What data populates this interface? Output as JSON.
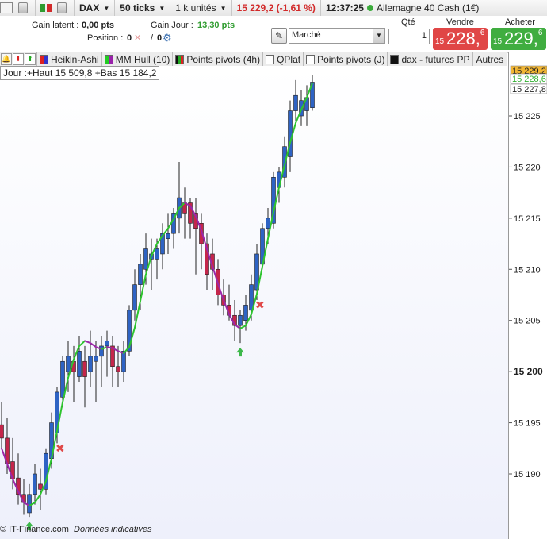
{
  "toolbar": {
    "instrument": "DAX",
    "ticks": "50 ticks",
    "units": "1 k unités",
    "price_change": "15 229,2 (-1,61 %)",
    "time": "12:37:25",
    "market": "Allemagne 40 Cash (1€)"
  },
  "order": {
    "gain_latent_label": "Gain latent :",
    "gain_latent_value": "0,00 pts",
    "gain_jour_label": "Gain Jour :",
    "gain_jour_value": "13,30 pts",
    "position_label": "Position :",
    "position_value": "0",
    "position_value2": "0",
    "order_type": "Marché",
    "qty_label": "Qté",
    "qty_value": "1",
    "sell_label": "Vendre",
    "sell_small": "15",
    "sell_big": "228,",
    "sell_sup": "6",
    "buy_label": "Acheter",
    "buy_small": "15",
    "buy_big": "229,",
    "buy_sup": "6"
  },
  "indicators": [
    "Heikin-Ashi",
    "MM Hull (10)",
    "Points pivots (4h)",
    "QPlat",
    "Points pivots (J)",
    "dax - futures PP",
    "Autres"
  ],
  "info_text": "Jour :+Haut 15 509,8 +Bas 15 184,2",
  "footer": {
    "source": "© IT-Finance.com",
    "note": "Données indicatives"
  },
  "price_labels": {
    "current": "15 229,2",
    "green": "15 228,6",
    "last": "15 227,8"
  },
  "colors": {
    "up": "#2e63c4",
    "down": "#c4264b",
    "hull_up": "#2ec42e",
    "hull_down": "#9b27a8",
    "current_price_bg": "#f2b633"
  },
  "chart_data": {
    "type": "candlestick",
    "y_ticks": [
      "15 190",
      "15 195",
      "15 200",
      "15 205",
      "15 210",
      "15 215",
      "15 220",
      "15 225"
    ],
    "ylim": [
      15185.5,
      15229.0
    ],
    "candles": [
      {
        "o": 15194.8,
        "h": 15197.0,
        "l": 15192.5,
        "c": 15193.5
      },
      {
        "o": 15193.5,
        "h": 15195.5,
        "l": 15190.0,
        "c": 15191.0
      },
      {
        "o": 15191.2,
        "h": 15193.5,
        "l": 15188.5,
        "c": 15189.5
      },
      {
        "o": 15189.6,
        "h": 15192.0,
        "l": 15187.0,
        "c": 15188.0
      },
      {
        "o": 15188.0,
        "h": 15189.5,
        "l": 15186.0,
        "c": 15187.2
      },
      {
        "o": 15186.2,
        "h": 15189.0,
        "l": 15185.8,
        "c": 15188.0
      },
      {
        "o": 15188.0,
        "h": 15191.0,
        "l": 15187.0,
        "c": 15190.0
      },
      {
        "o": 15189.0,
        "h": 15190.5,
        "l": 15186.5,
        "c": 15188.5
      },
      {
        "o": 15188.5,
        "h": 15192.5,
        "l": 15188.0,
        "c": 15192.0
      },
      {
        "o": 15191.5,
        "h": 15196.0,
        "l": 15190.5,
        "c": 15195.0
      },
      {
        "o": 15194.0,
        "h": 15198.5,
        "l": 15193.0,
        "c": 15198.0
      },
      {
        "o": 15197.5,
        "h": 15201.5,
        "l": 15196.5,
        "c": 15201.0
      },
      {
        "o": 15200.0,
        "h": 15203.0,
        "l": 15198.0,
        "c": 15201.5
      },
      {
        "o": 15201.0,
        "h": 15202.5,
        "l": 15197.0,
        "c": 15200.0
      },
      {
        "o": 15199.5,
        "h": 15203.5,
        "l": 15199.0,
        "c": 15202.0
      },
      {
        "o": 15201.0,
        "h": 15202.5,
        "l": 15196.5,
        "c": 15199.5
      },
      {
        "o": 15200.0,
        "h": 15204.0,
        "l": 15198.5,
        "c": 15201.5
      },
      {
        "o": 15201.0,
        "h": 15203.0,
        "l": 15197.0,
        "c": 15201.5
      },
      {
        "o": 15201.5,
        "h": 15203.5,
        "l": 15198.5,
        "c": 15202.5
      },
      {
        "o": 15202.5,
        "h": 15204.0,
        "l": 15199.5,
        "c": 15203.0
      },
      {
        "o": 15202.5,
        "h": 15203.5,
        "l": 15198.5,
        "c": 15200.5
      },
      {
        "o": 15200.5,
        "h": 15202.5,
        "l": 15198.5,
        "c": 15200.0
      },
      {
        "o": 15200.0,
        "h": 15203.0,
        "l": 15199.0,
        "c": 15202.0
      },
      {
        "o": 15202.0,
        "h": 15206.5,
        "l": 15201.5,
        "c": 15206.0
      },
      {
        "o": 15206.0,
        "h": 15210.0,
        "l": 15205.0,
        "c": 15208.5
      },
      {
        "o": 15208.5,
        "h": 15211.5,
        "l": 15206.0,
        "c": 15210.5
      },
      {
        "o": 15210.0,
        "h": 15213.5,
        "l": 15208.5,
        "c": 15212.0
      },
      {
        "o": 15211.0,
        "h": 15213.0,
        "l": 15208.0,
        "c": 15211.5
      },
      {
        "o": 15211.0,
        "h": 15213.0,
        "l": 15209.0,
        "c": 15212.0
      },
      {
        "o": 15211.5,
        "h": 15214.5,
        "l": 15210.0,
        "c": 15213.5
      },
      {
        "o": 15213.0,
        "h": 15215.5,
        "l": 15211.5,
        "c": 15213.5
      },
      {
        "o": 15213.5,
        "h": 15216.0,
        "l": 15212.0,
        "c": 15215.5
      },
      {
        "o": 15215.0,
        "h": 15220.5,
        "l": 15213.5,
        "c": 15217.0
      },
      {
        "o": 15216.5,
        "h": 15218.0,
        "l": 15213.0,
        "c": 15215.5
      },
      {
        "o": 15216.5,
        "h": 15217.0,
        "l": 15213.0,
        "c": 15214.5
      },
      {
        "o": 15215.5,
        "h": 15217.0,
        "l": 15209.5,
        "c": 15214.0
      },
      {
        "o": 15214.5,
        "h": 15215.5,
        "l": 15210.0,
        "c": 15212.5
      },
      {
        "o": 15212.5,
        "h": 15213.5,
        "l": 15208.0,
        "c": 15209.5
      },
      {
        "o": 15211.5,
        "h": 15213.0,
        "l": 15208.0,
        "c": 15210.0
      },
      {
        "o": 15210.0,
        "h": 15211.0,
        "l": 15206.5,
        "c": 15207.5
      },
      {
        "o": 15207.5,
        "h": 15209.0,
        "l": 15205.5,
        "c": 15206.5
      },
      {
        "o": 15206.5,
        "h": 15208.5,
        "l": 15205.0,
        "c": 15205.5
      },
      {
        "o": 15205.5,
        "h": 15207.0,
        "l": 15203.0,
        "c": 15204.5
      },
      {
        "o": 15204.5,
        "h": 15206.0,
        "l": 15202.8,
        "c": 15205.5
      },
      {
        "o": 15205.0,
        "h": 15207.5,
        "l": 15204.0,
        "c": 15206.5
      },
      {
        "o": 15206.0,
        "h": 15209.5,
        "l": 15205.0,
        "c": 15208.5
      },
      {
        "o": 15208.0,
        "h": 15212.5,
        "l": 15207.0,
        "c": 15211.5
      },
      {
        "o": 15210.5,
        "h": 15214.5,
        "l": 15210.0,
        "c": 15214.0
      },
      {
        "o": 15214.0,
        "h": 15216.0,
        "l": 15212.5,
        "c": 15215.0
      },
      {
        "o": 15214.5,
        "h": 15219.5,
        "l": 15214.0,
        "c": 15219.0
      },
      {
        "o": 15218.0,
        "h": 15220.0,
        "l": 15216.5,
        "c": 15219.5
      },
      {
        "o": 15219.0,
        "h": 15223.0,
        "l": 15218.0,
        "c": 15222.0
      },
      {
        "o": 15221.0,
        "h": 15226.5,
        "l": 15219.5,
        "c": 15225.5
      },
      {
        "o": 15225.5,
        "h": 15228.5,
        "l": 15224.5,
        "c": 15227.0
      },
      {
        "o": 15225.0,
        "h": 15227.5,
        "l": 15224.0,
        "c": 15226.5
      },
      {
        "o": 15225.5,
        "h": 15228.0,
        "l": 15224.0,
        "c": 15226.8
      },
      {
        "o": 15225.8,
        "h": 15229.0,
        "l": 15225.5,
        "c": 15228.3
      }
    ],
    "hull": [
      15192.5,
      15191.0,
      15189.5,
      15188.3,
      15187.2,
      15186.9,
      15187.2,
      15188.0,
      15189.3,
      15191.5,
      15194.2,
      15197.0,
      15199.4,
      15201.2,
      15202.5,
      15203.0,
      15202.8,
      15202.4,
      15202.2,
      15202.4,
      15202.3,
      15202.0,
      15201.8,
      15202.4,
      15204.3,
      15206.9,
      15209.5,
      15211.3,
      15212.5,
      15213.3,
      15214.0,
      15214.9,
      15216.0,
      15216.5,
      15216.2,
      15215.2,
      15213.8,
      15212.0,
      15210.3,
      15208.6,
      15207.0,
      15205.6,
      15204.6,
      15204.2,
      15204.5,
      15205.6,
      15207.6,
      15210.3,
      15213.0,
      15215.6,
      15218.0,
      15220.2,
      15222.4,
      15224.3,
      15225.6,
      15226.8,
      15228.2
    ],
    "arrows_up": [
      5,
      43
    ],
    "marks_x": [
      10,
      46
    ]
  }
}
